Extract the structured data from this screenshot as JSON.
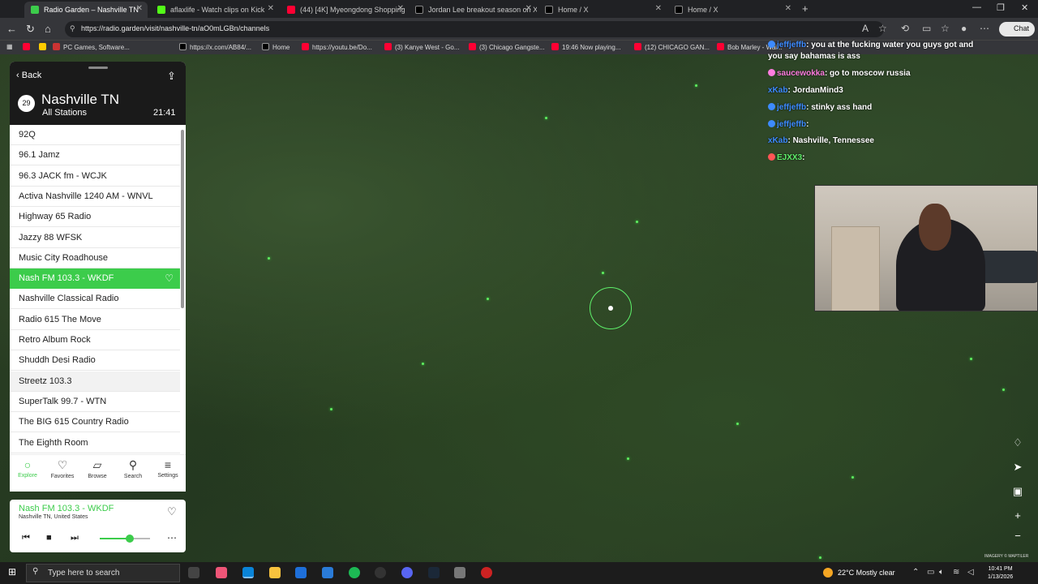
{
  "browser": {
    "tabs": [
      {
        "label": "Radio Garden – Nashville TN",
        "active": true
      },
      {
        "label": "aflaxlife - Watch clips on Kick"
      },
      {
        "label": "(44) [4K] Myeongdong Shopping"
      },
      {
        "label": "Jordan Lee breakout season on X"
      },
      {
        "label": "Home / X"
      },
      {
        "label": "Home / X"
      }
    ],
    "new_tab": "+",
    "url": "https://radio.garden/visit/nashville-tn/aO0mLGBn/channels",
    "chat_button": "Chat",
    "bookmarks": [
      "PC Games, Software...",
      "https://x.com/AB84/...",
      "Home",
      "https://youtu.be/Do...",
      "(3) Kanye West - Go...",
      "(3) Chicago Gangste...",
      "19:46 Now playing...",
      "(12) CHICAGO GAN...",
      "Bob Marley - Wai..."
    ]
  },
  "chat": [
    {
      "user": "jeffjeffb",
      "message": "you at the fucking water you guys got and",
      "color": "blue"
    },
    {
      "user": "",
      "message": "you say bahamas is ass",
      "color": "blue"
    },
    {
      "user": "saucewokka",
      "message": "go to moscow russia",
      "color": "pink"
    },
    {
      "user": "xKab",
      "message": "JordanMind3",
      "color": "blue"
    },
    {
      "user": "jeffjeffb",
      "message": "stinky ass hand",
      "color": "blue"
    },
    {
      "user": "jeffjeffb",
      "message": "",
      "color": "blue"
    },
    {
      "user": "xKab",
      "message": "Nashville, Tennessee",
      "color": "blue"
    },
    {
      "user": "EJXX3",
      "message": "",
      "color": "green"
    }
  ],
  "radio": {
    "back_label": "Back",
    "station_count": "29",
    "city": "Nashville TN",
    "subtitle": "All Stations",
    "time": "21:41",
    "stations": [
      "92Q",
      "96.1 Jamz",
      "96.3 JACK fm - WCJK",
      "Activa Nashville 1240 AM - WNVL",
      "Highway 65 Radio",
      "Jazzy 88 WFSK",
      "Music City Roadhouse",
      "Nash FM 103.3 - WKDF",
      "Nashville Classical Radio",
      "Radio 615 The Move",
      "Retro Album Rock",
      "Shuddh Desi Radio",
      "Streetz 103.3",
      "SuperTalk 99.7 - WTN",
      "The BIG 615 Country Radio",
      "The Eighth Room"
    ],
    "selected_index": 7,
    "hover_index": 12,
    "nav": [
      {
        "label": "Explore",
        "icon": "explore-icon"
      },
      {
        "label": "Favorites",
        "icon": "heart-icon"
      },
      {
        "label": "Browse",
        "icon": "map-icon"
      },
      {
        "label": "Search",
        "icon": "search-icon"
      },
      {
        "label": "Settings",
        "icon": "menu-icon"
      }
    ],
    "active_nav": 0,
    "now_playing": {
      "station": "Nash FM 103.3 - WKDF",
      "location": "Nashville TN, United States",
      "volume": 0.6
    }
  },
  "map": {
    "attribution": "IMAGERY © MAPTILER"
  },
  "taskbar": {
    "search_placeholder": "Type here to search",
    "weather": "22°C  Mostly clear",
    "clock_time": "10:41 PM",
    "clock_date": "1/13/2026"
  },
  "colors": {
    "accent": "#3ccc4b",
    "map_bg": "#2a3f24"
  }
}
